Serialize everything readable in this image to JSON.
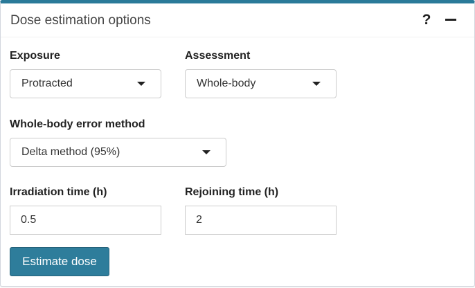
{
  "panel": {
    "title": "Dose estimation options",
    "help_symbol": "?",
    "accent_color": "#2a7a99"
  },
  "form": {
    "exposure": {
      "label": "Exposure",
      "value": "Protracted"
    },
    "assessment": {
      "label": "Assessment",
      "value": "Whole-body"
    },
    "error_method": {
      "label": "Whole-body error method",
      "value": "Delta method (95%)"
    },
    "irradiation_time": {
      "label": "Irradiation time (h)",
      "value": "0.5"
    },
    "rejoining_time": {
      "label": "Rejoining time (h)",
      "value": "2"
    }
  },
  "actions": {
    "estimate_label": "Estimate dose",
    "button_color": "#2e7d9b"
  }
}
